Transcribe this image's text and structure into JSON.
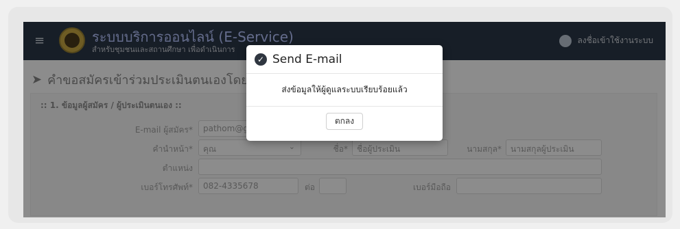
{
  "header": {
    "title": "ระบบบริการออนไลน์ (E-Service)",
    "subtitle": "สำหรับชุมชนและสถานศึกษา เพื่อดำเนินการ",
    "user_label": "ลงชื่อเข้าใช้งานระบบ"
  },
  "page": {
    "title": "คำขอสมัครเข้าร่วมประเมินตนเองโดย",
    "section_title": ":: 1. ข้อมูลผู้สมัคร / ผู้ประเมินตนเอง ::"
  },
  "form": {
    "email_label": "E-mail ผู้สมัคร*",
    "email_value": "pathom@gm",
    "prefix_label": "คำนำหน้า*",
    "prefix_value": "คุณ",
    "name_label": "ชื่อ*",
    "name_value": "ชื่อผู้ประเมิน",
    "surname_label": "นามสกุล*",
    "surname_value": "นามสกุลผู้ประเมิน",
    "position_label": "ตำแหน่ง",
    "phone_label": "เบอร์โทรศัพท์*",
    "phone_value": "082-4335678",
    "ext_label": "ต่อ",
    "mobile_label": "เบอร์มือถือ"
  },
  "modal": {
    "title": "Send E-mail",
    "message": "ส่งข้อมูลให้ผู้ดูแลระบบเรียบร้อยแล้ว",
    "ok_label": "ตกลง"
  }
}
